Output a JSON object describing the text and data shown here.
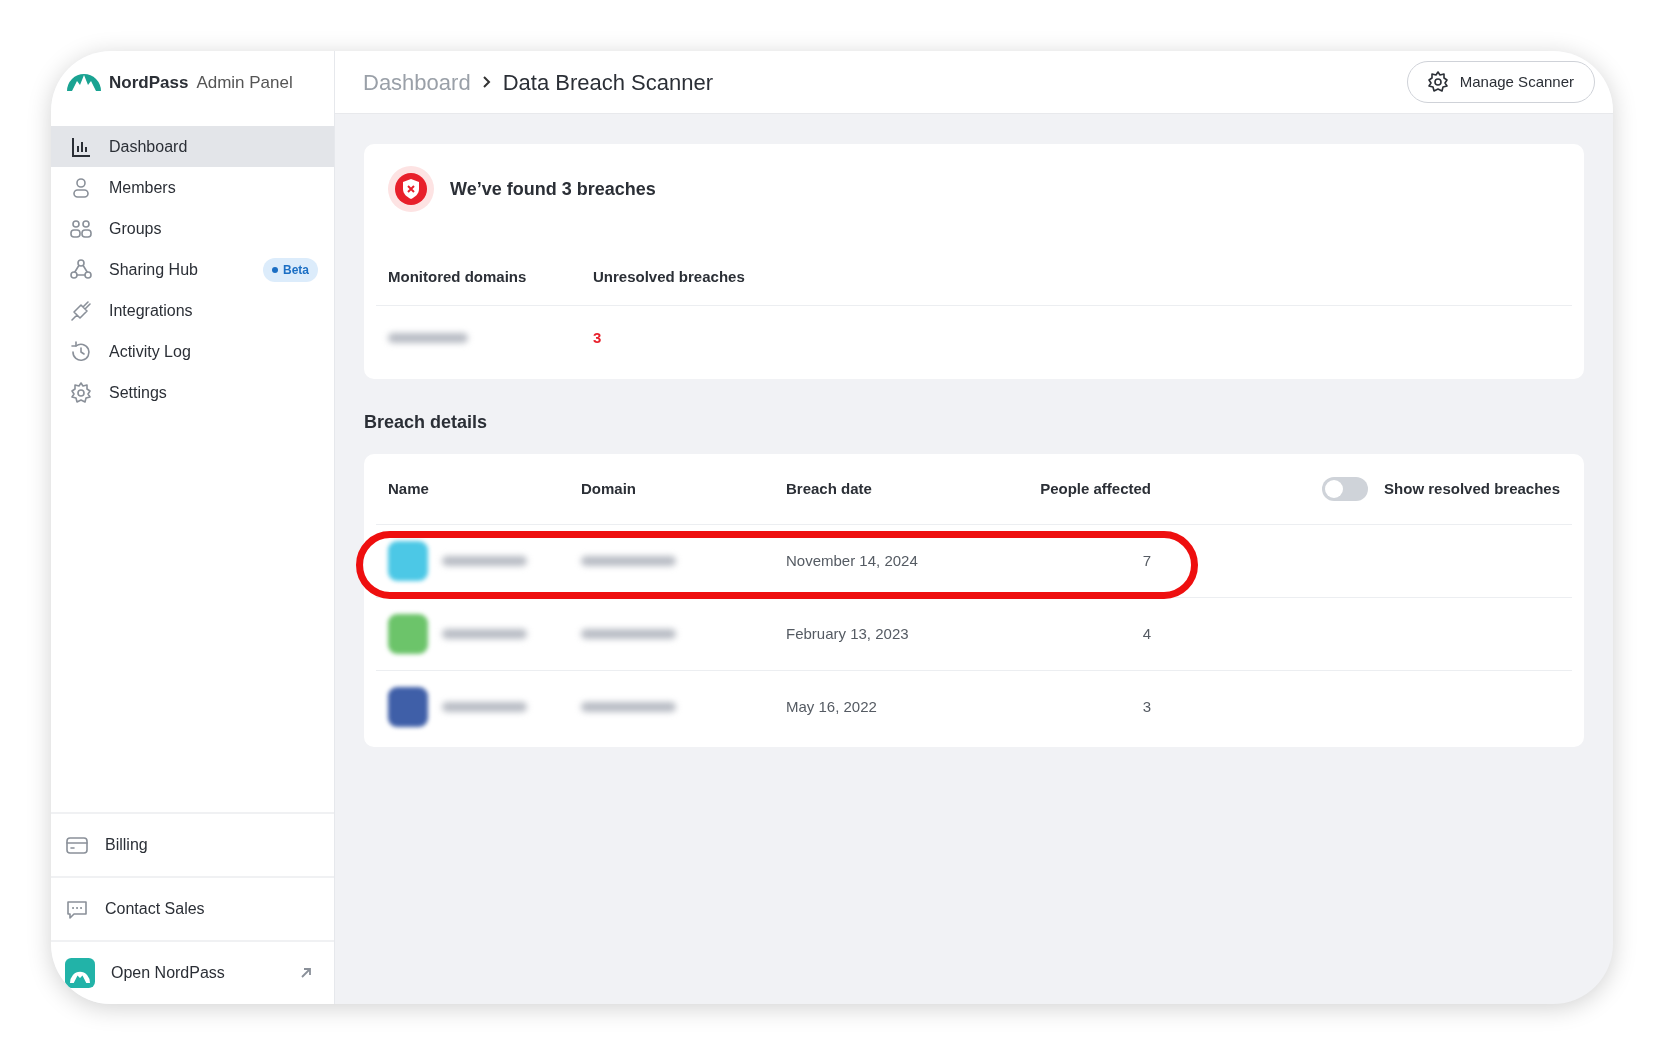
{
  "app": {
    "brand": "NordPass",
    "subtitle": "Admin Panel"
  },
  "sidebar": {
    "items": [
      {
        "label": "Dashboard",
        "kind": "chart",
        "selected": true
      },
      {
        "label": "Members",
        "kind": "person",
        "selected": false
      },
      {
        "label": "Groups",
        "kind": "people",
        "selected": false
      },
      {
        "label": "Sharing Hub",
        "kind": "hub",
        "selected": false,
        "badge": "Beta"
      },
      {
        "label": "Integrations",
        "kind": "plug",
        "selected": false
      },
      {
        "label": "Activity Log",
        "kind": "history",
        "selected": false
      },
      {
        "label": "Settings",
        "kind": "gear",
        "selected": false
      }
    ],
    "footer_items": [
      {
        "label": "Billing",
        "kind": "card"
      },
      {
        "label": "Contact Sales",
        "kind": "chat"
      },
      {
        "label": "Open NordPass",
        "kind": "app",
        "external": true
      }
    ]
  },
  "breadcrumb": [
    "Dashboard",
    "Data Breach Scanner"
  ],
  "header_button": "Manage Scanner",
  "summary": {
    "title": "We’ve found 3 breaches",
    "columns": [
      "Monitored domains",
      "Unresolved breaches"
    ],
    "unresolved": "3"
  },
  "details": {
    "title": "Breach details",
    "columns": [
      "Name",
      "Domain",
      "Breach date",
      "People affected"
    ],
    "toggle": {
      "label": "Show resolved breaches",
      "on": false
    },
    "rows": [
      {
        "color": "#4cc8e6",
        "date": "November 14, 2024",
        "people": "7",
        "highlighted": true
      },
      {
        "color": "#6cc46a",
        "date": "February 13, 2023",
        "people": "4",
        "highlighted": false
      },
      {
        "color": "#3f5fa8",
        "date": "May 16, 2022",
        "people": "3",
        "highlighted": false
      }
    ]
  }
}
